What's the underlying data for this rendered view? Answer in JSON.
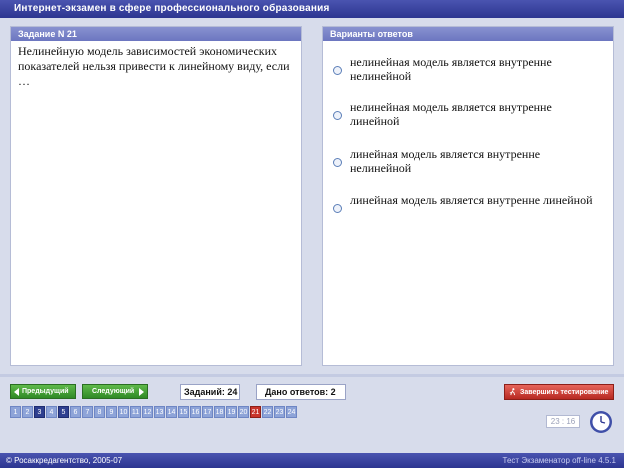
{
  "header": {
    "title": "Интернет-экзамен в сфере профессионального образования"
  },
  "question_panel": {
    "title": "Задание N 21",
    "text": "Нелинейную модель зависимостей экономических показателей нельзя привести к линейному виду, если …"
  },
  "answers_panel": {
    "title": "Варианты ответов",
    "options": [
      "нелинейная модель является внутренне нелинейной",
      "нелинейная модель является внутренне линейной",
      "линейная модель является внутренне нелинейной",
      "линейная модель является внутренне линейной"
    ]
  },
  "nav": {
    "prev_label": "Предыдущий",
    "next_label": "Следующий",
    "tasks_label": "Заданий: 24",
    "answered_label": "Дано ответов: 2",
    "finish_label": "Завершить тестирование"
  },
  "question_numbers": [
    "1",
    "2",
    "3",
    "4",
    "5",
    "6",
    "7",
    "8",
    "9",
    "10",
    "11",
    "12",
    "13",
    "14",
    "15",
    "16",
    "17",
    "18",
    "19",
    "20",
    "21",
    "22",
    "23",
    "24"
  ],
  "done_questions": [
    "3",
    "5"
  ],
  "current_question": "21",
  "timer": "23 : 16",
  "footer": {
    "copyright": "© Росаккредагентство, 2005-07",
    "version": "Тест Экзаменатор off-line 4.5.1"
  },
  "colors": {
    "header": "#2c3590",
    "panel_head": "#6c76c0",
    "nav_button": "#2f8a26",
    "finish_button": "#b72a22",
    "current_question": "#c8342a"
  },
  "icons": [
    "arrow-left-icon",
    "arrow-right-icon",
    "runner-icon",
    "clock-icon",
    "radio-icon"
  ]
}
